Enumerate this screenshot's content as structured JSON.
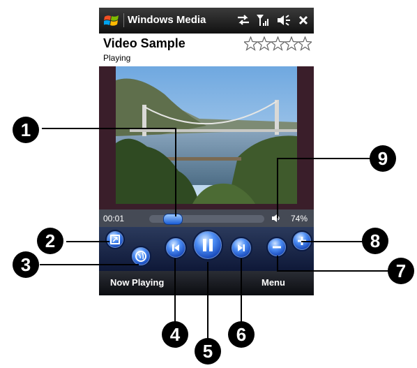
{
  "titlebar": {
    "app_title": "Windows Media",
    "icons": [
      "windows-logo",
      "connectivity-arrows",
      "signal-strength",
      "speaker-volume",
      "close-x"
    ]
  },
  "header": {
    "title": "Video Sample",
    "subtitle": "Playing",
    "rating": 0,
    "max_rating": 5
  },
  "playback": {
    "elapsed": "00:01",
    "progress": 0.22,
    "volume_label": "74%",
    "volume": 0.74
  },
  "controls": [
    "full-screen",
    "play-on-internet",
    "previous",
    "pause",
    "next",
    "volume-down",
    "volume-up"
  ],
  "softkeys": {
    "left": "Now Playing",
    "right": "Menu"
  },
  "callouts": [
    "1",
    "2",
    "3",
    "4",
    "5",
    "6",
    "7",
    "8",
    "9"
  ],
  "colors": {
    "accent_blue": "#2a6de0",
    "control_bar": "#1a2a55",
    "video_frame": "#3a1e2a"
  }
}
